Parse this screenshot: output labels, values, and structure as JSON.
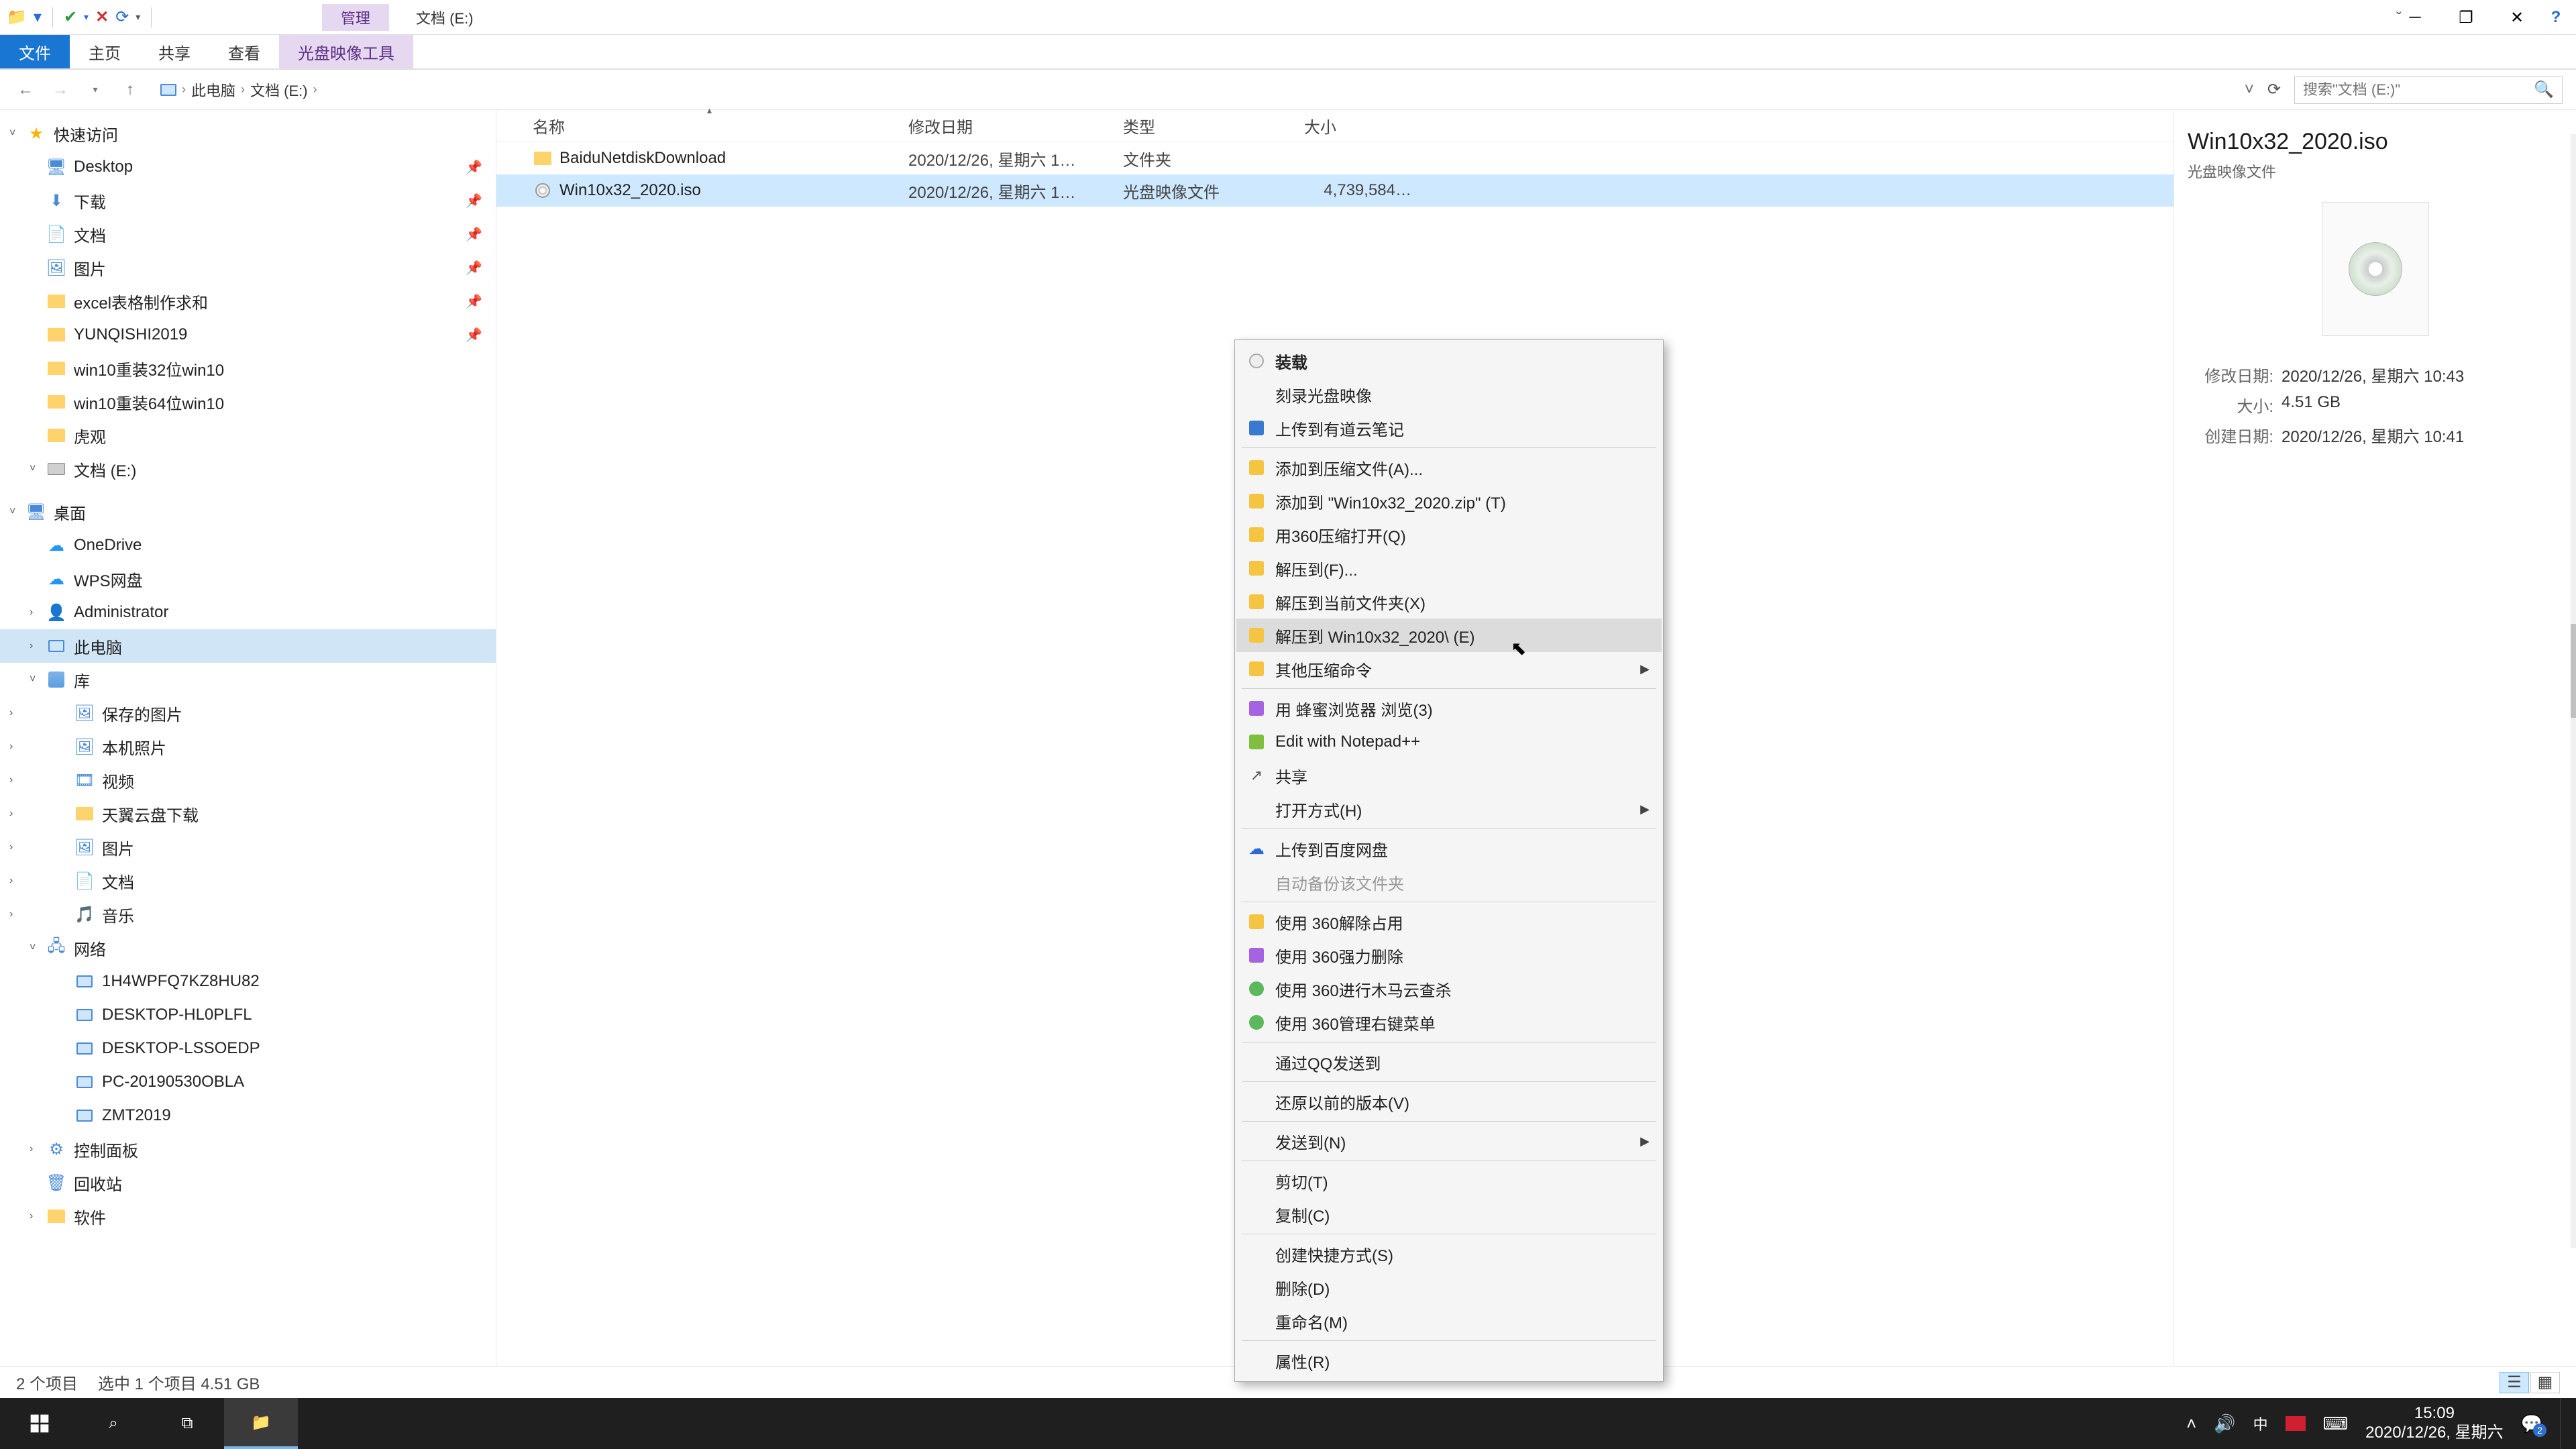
{
  "title": {
    "context_tab": "管理",
    "window_title": "文档 (E:)"
  },
  "ribbon": {
    "file": "文件",
    "home": "主页",
    "share": "共享",
    "view": "查看",
    "disc_tools": "光盘映像工具"
  },
  "address": {
    "this_pc": "此电脑",
    "drive": "文档 (E:)",
    "search_placeholder": "搜索\"文档 (E:)\""
  },
  "sidebar": {
    "quick_access": "快速访问",
    "desktop": "Desktop",
    "downloads": "下载",
    "documents": "文档",
    "pictures": "图片",
    "excel_templates": "excel表格制作求和",
    "yunqishi": "YUNQISHI2019",
    "win10_32": "win10重装32位win10",
    "win10_64": "win10重装64位win10",
    "huguan": "虎观",
    "doc_e": "文档 (E:)",
    "desktop2": "桌面",
    "onedrive": "OneDrive",
    "wps": "WPS网盘",
    "admin": "Administrator",
    "this_pc": "此电脑",
    "libraries": "库",
    "saved_pics": "保存的图片",
    "local_photos": "本机照片",
    "videos": "视频",
    "tianyi": "天翼云盘下载",
    "pictures2": "图片",
    "documents2": "文档",
    "music": "音乐",
    "network": "网络",
    "net1": "1H4WPFQ7KZ8HU82",
    "net2": "DESKTOP-HL0PLFL",
    "net3": "DESKTOP-LSSOEDP",
    "net4": "PC-20190530OBLA",
    "net5": "ZMT2019",
    "control_panel": "控制面板",
    "recycle": "回收站",
    "software": "软件"
  },
  "columns": {
    "name": "名称",
    "date": "修改日期",
    "type": "类型",
    "size": "大小"
  },
  "files": [
    {
      "name": "BaiduNetdiskDownload",
      "date": "2020/12/26, 星期六 1…",
      "type": "文件夹",
      "size": "",
      "kind": "folder"
    },
    {
      "name": "Win10x32_2020.iso",
      "date": "2020/12/26, 星期六 1…",
      "type": "光盘映像文件",
      "size": "4,739,584…",
      "kind": "iso",
      "selected": true
    }
  ],
  "context_menu": [
    {
      "label": "装载",
      "icon": "cd",
      "bold": true
    },
    {
      "label": "刻录光盘映像"
    },
    {
      "label": "上传到有道云笔记",
      "icon": "blue"
    },
    {
      "sep": true
    },
    {
      "label": "添加到压缩文件(A)...",
      "icon": "yellow"
    },
    {
      "label": "添加到 \"Win10x32_2020.zip\" (T)",
      "icon": "yellow"
    },
    {
      "label": "用360压缩打开(Q)",
      "icon": "yellow"
    },
    {
      "label": "解压到(F)...",
      "icon": "yellow"
    },
    {
      "label": "解压到当前文件夹(X)",
      "icon": "yellow"
    },
    {
      "label": "解压到 Win10x32_2020\\ (E)",
      "icon": "yellow",
      "hover": true
    },
    {
      "label": "其他压缩命令",
      "icon": "yellow",
      "submenu": true
    },
    {
      "sep": true
    },
    {
      "label": "用 蜂蜜浏览器 浏览(3)",
      "icon": "purple"
    },
    {
      "label": "Edit with Notepad++",
      "icon": "green-sq"
    },
    {
      "label": "共享",
      "icon": "share"
    },
    {
      "label": "打开方式(H)",
      "submenu": true
    },
    {
      "sep": true
    },
    {
      "label": "上传到百度网盘",
      "icon": "cloud"
    },
    {
      "label": "自动备份该文件夹",
      "disabled": true
    },
    {
      "sep": true
    },
    {
      "label": "使用 360解除占用",
      "icon": "yellow"
    },
    {
      "label": "使用 360强力删除",
      "icon": "purple"
    },
    {
      "label": "使用 360进行木马云查杀",
      "icon": "green"
    },
    {
      "label": "使用 360管理右键菜单",
      "icon": "green"
    },
    {
      "sep": true
    },
    {
      "label": "通过QQ发送到"
    },
    {
      "sep": true
    },
    {
      "label": "还原以前的版本(V)"
    },
    {
      "sep": true
    },
    {
      "label": "发送到(N)",
      "submenu": true
    },
    {
      "sep": true
    },
    {
      "label": "剪切(T)"
    },
    {
      "label": "复制(C)"
    },
    {
      "sep": true
    },
    {
      "label": "创建快捷方式(S)"
    },
    {
      "label": "删除(D)"
    },
    {
      "label": "重命名(M)"
    },
    {
      "sep": true
    },
    {
      "label": "属性(R)"
    }
  ],
  "details": {
    "filename": "Win10x32_2020.iso",
    "filetype": "光盘映像文件",
    "rows": [
      {
        "k": "修改日期:",
        "v": "2020/12/26, 星期六 10:43"
      },
      {
        "k": "大小:",
        "v": "4.51 GB"
      },
      {
        "k": "创建日期:",
        "v": "2020/12/26, 星期六 10:41"
      }
    ]
  },
  "statusbar": {
    "items": "2 个项目",
    "selected": "选中 1 个项目  4.51 GB"
  },
  "taskbar": {
    "ime": "中",
    "time": "15:09",
    "date": "2020/12/26, 星期六",
    "notif_count": "2"
  }
}
